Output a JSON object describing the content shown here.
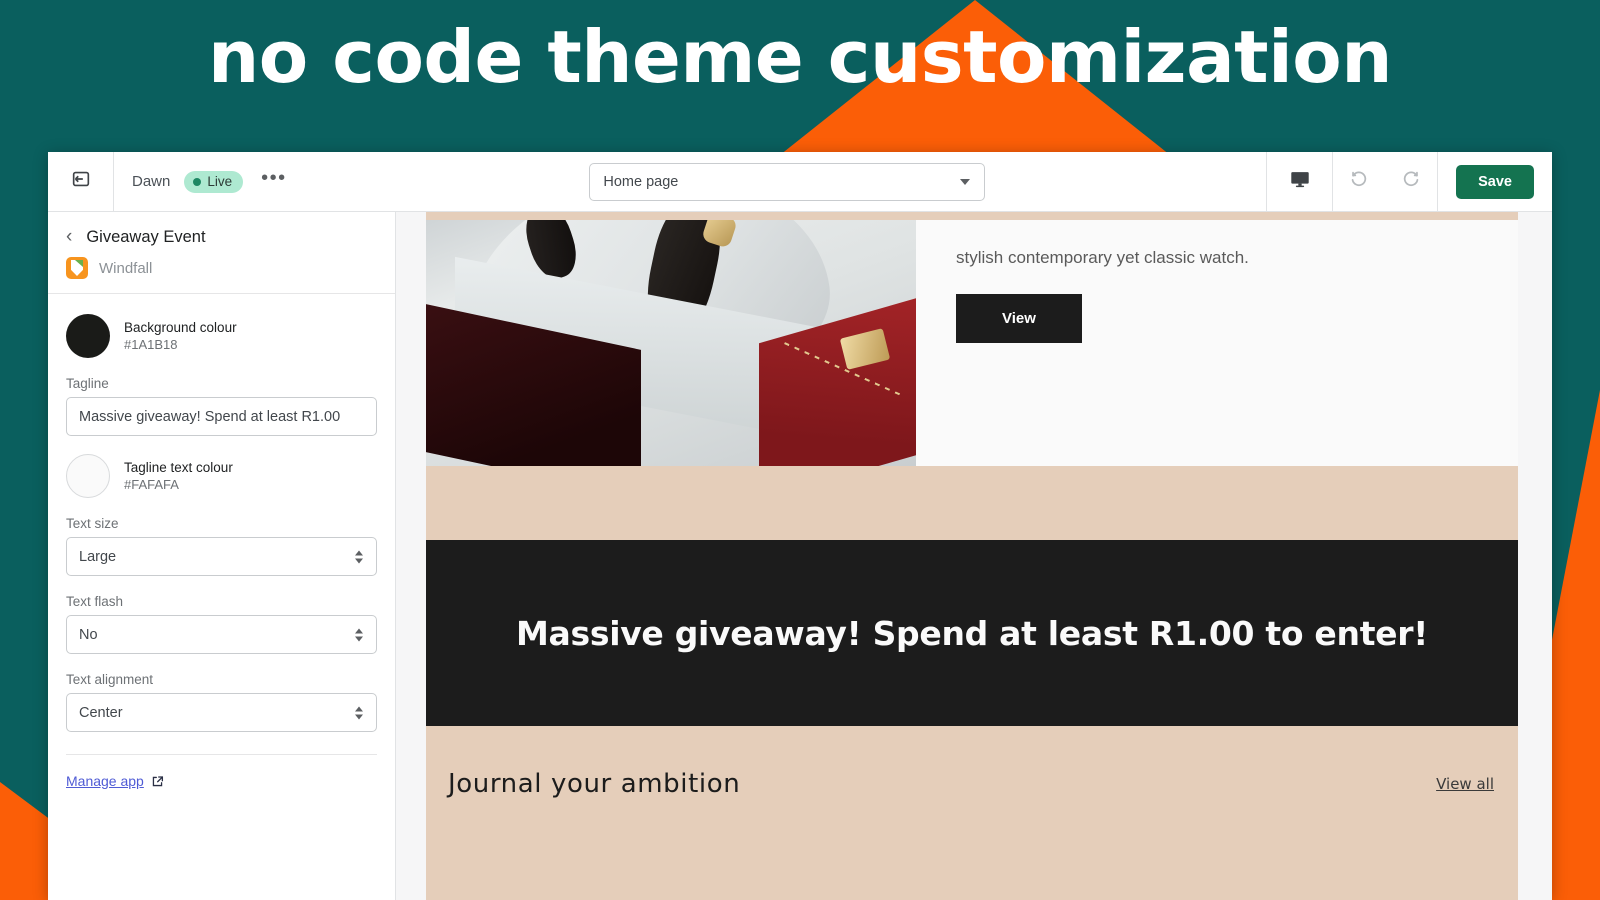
{
  "promo": {
    "headline": "no code theme customization",
    "bg_color": "#0A5F5E",
    "accent_color": "#FB5E07"
  },
  "toolbar": {
    "exit_icon": "exit-editor-icon",
    "theme_name": "Dawn",
    "live_badge": "Live",
    "more_menu": "•••",
    "page_selector_value": "Home page",
    "device_icon": "desktop-view-icon",
    "undo_icon": "undo-icon",
    "redo_icon": "redo-icon",
    "save_label": "Save",
    "save_color": "#147350"
  },
  "sidebar": {
    "back_icon": "chevron-left-icon",
    "section_title": "Giveaway Event",
    "app_icon": "windfall-app-icon",
    "app_name": "Windfall",
    "background_colour": {
      "label": "Background colour",
      "value": "#1A1B18"
    },
    "tagline": {
      "label": "Tagline",
      "value": "Massive giveaway! Spend at least R1.00"
    },
    "tagline_text_colour": {
      "label": "Tagline text colour",
      "value": "#FAFAFA"
    },
    "text_size": {
      "label": "Text size",
      "value": "Large"
    },
    "text_flash": {
      "label": "Text flash",
      "value": "No"
    },
    "text_alignment": {
      "label": "Text alignment",
      "value": "Center"
    },
    "manage_app": {
      "label": "Manage app",
      "icon": "external-link-icon"
    }
  },
  "preview": {
    "background_color": "#E5CEBA",
    "hero": {
      "image_alt": "watch-in-red-presentation-box",
      "description": "stylish contemporary yet classic watch.",
      "button_label": "View"
    },
    "giveaway_banner": {
      "text": "Massive giveaway! Spend at least R1.00 to enter!",
      "background": "#1C1C1C",
      "text_color": "#FAFAFA"
    },
    "journal_section": {
      "title": "Journal your ambition",
      "view_all_label": "View all"
    }
  }
}
